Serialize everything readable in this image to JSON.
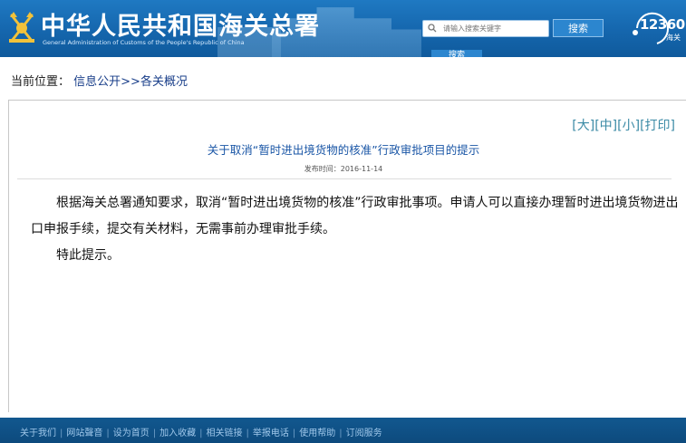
{
  "header": {
    "site_title": "中华人民共和国海关总署",
    "site_subtitle": "General Administration of Customs of the People's Republic of China",
    "search_placeholder": "请输入搜索关键字",
    "search_button": "搜索",
    "tab_fragment": "搜索",
    "hotline_number": "12360",
    "hotline_label": "海关"
  },
  "breadcrumb": {
    "prefix": "当前位置：",
    "path": "信息公开>>各关概况"
  },
  "article": {
    "font_tools": [
      "[大]",
      "[中]",
      "[小]",
      "[打印]"
    ],
    "title": "关于取消“暂时进出境货物的核准”行政审批项目的提示",
    "publish_label": "发布时间：",
    "publish_date": "2016-11-14",
    "paragraphs": [
      "根据海关总署通知要求，取消“暂时进出境货物的核准”行政审批事项。申请人可以直接办理暂时进出境货物进出口申报手续，提交有关材料，无需事前办理审批手续。",
      "特此提示。"
    ]
  },
  "footer": {
    "links": [
      "关于我们",
      "网站聲音",
      "设为首页",
      "加入收藏",
      "相关链接",
      "举报电话",
      "使用帮助",
      "订阅服务"
    ]
  },
  "colors": {
    "header_blue": "#1566ad",
    "title_blue": "#1a56a6",
    "footer_blue": "#0d4a7d"
  }
}
